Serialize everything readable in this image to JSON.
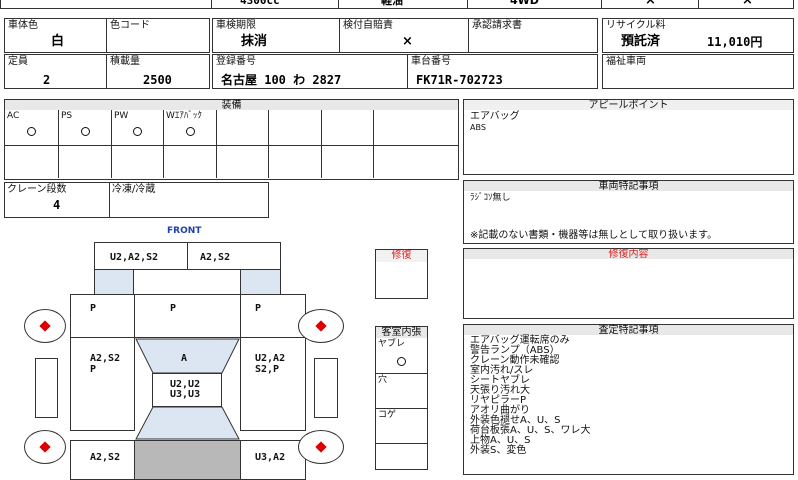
{
  "top_row": {
    "displacement": "4300cc",
    "fuel": "軽油",
    "drive": "4WD",
    "x1": "×",
    "x2": "×"
  },
  "body_color": {
    "label": "車体色",
    "value": "白"
  },
  "color_code": {
    "label": "色コード",
    "value": ""
  },
  "inspection": {
    "label": "車検期限",
    "value": "抹消"
  },
  "insurance": {
    "label": "検付自賠責",
    "value": "×"
  },
  "approval": {
    "label": "承認請求書",
    "value": ""
  },
  "recycle": {
    "label": "リサイクル料",
    "status": "預託済",
    "amount": "11,010円"
  },
  "capacity": {
    "label": "定員",
    "value": "2"
  },
  "load": {
    "label": "積載量",
    "value": "2500"
  },
  "registration": {
    "label": "登録番号",
    "value": "名古屋 100 わ 2827"
  },
  "chassis": {
    "label": "車台番号",
    "value": "FK71R-702723"
  },
  "welfare": {
    "label": "福祉車両",
    "value": ""
  },
  "equipment": {
    "title": "装備",
    "items": [
      {
        "label": "AC",
        "mark": true
      },
      {
        "label": "PS",
        "mark": true
      },
      {
        "label": "PW",
        "mark": true
      },
      {
        "label": "Wｴｱﾊﾞｯｸ",
        "mark": true
      }
    ]
  },
  "crane": {
    "label": "クレーン段数",
    "value": "4"
  },
  "fridge": {
    "label": "冷凍/冷蔵",
    "value": ""
  },
  "appeal": {
    "title": "アピールポイント",
    "lines": [
      "エアバッグ",
      "ABS"
    ]
  },
  "special_vehicle": {
    "title": "車両特記事項",
    "line1": "ﾗｼﾞｺｿ無し",
    "line2": "※記載のない書類・機器等は無しとして取り扱います。"
  },
  "repair": {
    "title": "修復内容",
    "label": "修復",
    "color": "#e02020"
  },
  "cabin": {
    "title": "客室内張",
    "items": [
      "ヤブレ",
      "穴",
      "コゲ"
    ],
    "mark": true
  },
  "assessment": {
    "title": "査定特記事項",
    "lines": [
      "エアバッグ運転席のみ",
      "警告ランプ（ABS）",
      "クレーン動作未確認",
      "室内汚れ/スレ",
      "シートヤブレ",
      "天張り汚れ大",
      "リヤピラーP",
      "アオリ曲がり",
      "外装色褪せA、U、S",
      "荷台板張A、U、S、ワレ大",
      "上物A、U、S",
      "外装S、変色"
    ]
  },
  "diagram": {
    "front_label": "FRONT",
    "front_color": "#1f3fb0",
    "parts": {
      "top_left": "U2,A2,S2",
      "top_right": "A2,S2",
      "p_left_upper": "P",
      "p_center_upper": "P",
      "p_right_upper": "P",
      "left_mid": "A2,S2\nP",
      "center_mid": "A",
      "right_mid": "U2,A2\nS2,P",
      "center_box": "U2,U2\nU3,U3",
      "bottom_left": "A2,S2",
      "bottom_right": "U3,A2"
    }
  }
}
